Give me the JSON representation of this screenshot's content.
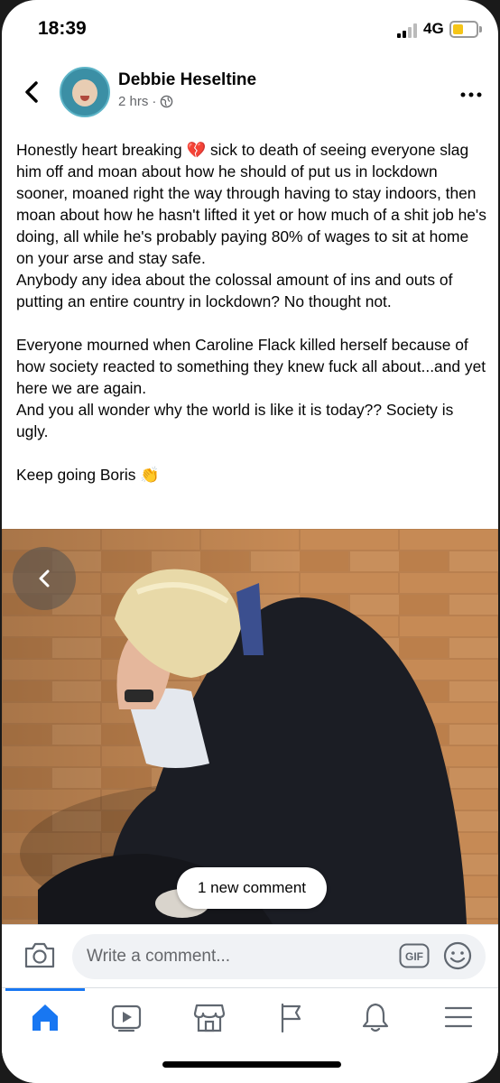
{
  "status_bar": {
    "time": "18:39",
    "network": "4G",
    "battery_color": "#f5c518"
  },
  "post": {
    "author": "Debbie Heseltine",
    "time_ago": "2 hrs",
    "audience_icon": "globe-icon",
    "paragraphs": [
      "Honestly heart breaking 💔 sick to death of seeing everyone slag him off and moan about how he should of put us in lockdown sooner, moaned right the way through having to stay indoors, then moan about how he hasn't lifted it yet or how much of a shit job he's doing, all while he's probably paying 80% of wages to sit at home on your arse and stay safe.",
      "Anybody any idea about the colossal amount of ins and outs of putting an entire country in lockdown? No thought not.",
      "",
      "Everyone mourned when Caroline Flack killed herself because of how society reacted to something they knew fuck all about...and yet here we are again.",
      "And you all wonder why the world is like it is today?? Society is ugly.",
      "",
      "Keep going Boris 👏"
    ]
  },
  "photo": {
    "prev_icon": "chevron-left-icon",
    "new_comment_label": "1 new comment"
  },
  "comment_bar": {
    "placeholder": "Write a comment...",
    "gif_label": "GIF"
  },
  "tabs": [
    {
      "name": "home",
      "icon": "home-icon",
      "active": true
    },
    {
      "name": "watch",
      "icon": "video-icon",
      "active": false
    },
    {
      "name": "marketplace",
      "icon": "marketplace-icon",
      "active": false
    },
    {
      "name": "pages",
      "icon": "flag-icon",
      "active": false
    },
    {
      "name": "notifications",
      "icon": "bell-icon",
      "active": false
    },
    {
      "name": "menu",
      "icon": "menu-icon",
      "active": false
    }
  ],
  "colors": {
    "accent": "#1877f2",
    "text": "#050505",
    "secondary_text": "#65676b",
    "input_bg": "#f0f2f5"
  }
}
